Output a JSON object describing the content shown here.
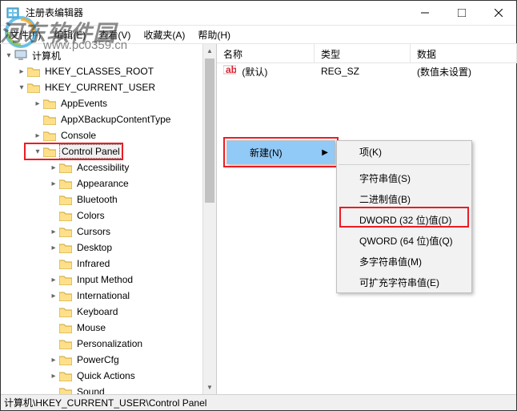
{
  "window": {
    "title": "注册表编辑器",
    "min": "—",
    "max": "□",
    "close": "×"
  },
  "menu": {
    "file": "文件(F)",
    "edit": "编辑(E)",
    "view": "查看(V)",
    "fav": "收藏夹(A)",
    "help": "帮助(H)"
  },
  "tree": {
    "root": "计算机",
    "hkcr": "HKEY_CLASSES_ROOT",
    "hkcu": "HKEY_CURRENT_USER",
    "items": [
      "AppEvents",
      "AppXBackupContentType",
      "Console",
      "Control Panel",
      "Accessibility",
      "Appearance",
      "Bluetooth",
      "Colors",
      "Cursors",
      "Desktop",
      "Infrared",
      "Input Method",
      "International",
      "Keyboard",
      "Mouse",
      "Personalization",
      "PowerCfg",
      "Quick Actions",
      "Sound"
    ]
  },
  "columns": {
    "name": "名称",
    "type": "类型",
    "data": "数据"
  },
  "row0": {
    "name": "(默认)",
    "type": "REG_SZ",
    "data": "(数值未设置)"
  },
  "menu1": {
    "new": "新建(N)"
  },
  "menu2": {
    "key": "项(K)",
    "string": "字符串值(S)",
    "binary": "二进制值(B)",
    "dword": "DWORD (32 位)值(D)",
    "qword": "QWORD (64 位)值(Q)",
    "multi": "多字符串值(M)",
    "expand": "可扩充字符串值(E)"
  },
  "status": "计算机\\HKEY_CURRENT_USER\\Control Panel",
  "watermark": {
    "text": "河东软件园",
    "url": "www.pc0359.cn"
  }
}
